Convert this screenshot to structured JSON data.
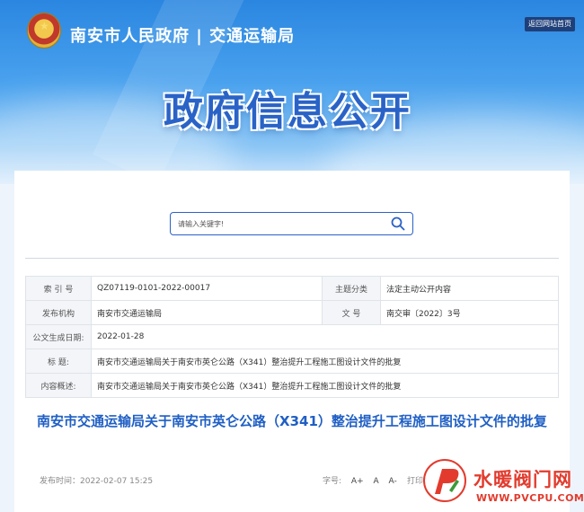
{
  "header": {
    "site_name": "南安市人民政府 | 交通运输局",
    "home_button": "返回网站首页",
    "banner_title": "政府信息公开"
  },
  "search": {
    "placeholder": "请输入关键字!"
  },
  "meta": {
    "index_label": "索 引 号",
    "index_value": "QZ07119-0101-2022-00017",
    "category_label": "主题分类",
    "category_value": "法定主动公开内容",
    "publisher_label": "发布机构",
    "publisher_value": "南安市交通运输局",
    "docno_label": "文 号",
    "docno_value": "南交审〔2022〕3号",
    "created_label": "公文生成日期:",
    "created_value": "2022-01-28",
    "title_label": "标 题:",
    "title_value": "南安市交通运输局关于南安市英仑公路（X341）整治提升工程施工图设计文件的批复",
    "summary_label": "内容概述:",
    "summary_value": "南安市交通运输局关于南安市英仑公路（X341）整治提升工程施工图设计文件的批复"
  },
  "article": {
    "title": "南安市交通运输局关于南安市英仑公路（X341）整治提升工程施工图设计文件的批复",
    "publish_time": "发布时间：2022-02-07 15:25",
    "font_size_label": "字号:",
    "font_large": "A+",
    "font_medium": "A",
    "font_small": "A-",
    "print_label": "打印"
  },
  "watermark": {
    "cn": "水暖阀门网",
    "url": "WWW.PVCPU.COM"
  },
  "colors": {
    "accent": "#1f5fc4",
    "watermark": "#e23b2d"
  }
}
